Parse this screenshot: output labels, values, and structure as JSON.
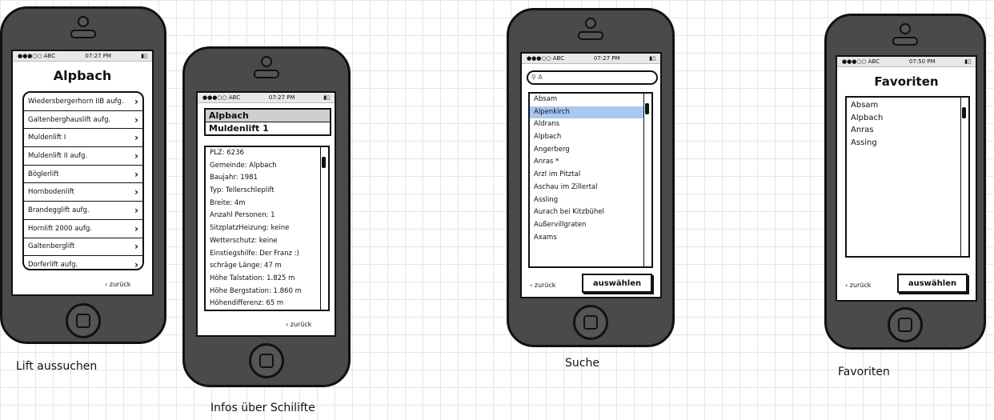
{
  "status": {
    "carrier": "●●●○○ ABC",
    "time1": "07:27 PM",
    "time4": "07:50 PM",
    "battery": "▮▯"
  },
  "back_label": "‹ zurück",
  "screen1": {
    "title": "Alpbach",
    "items": [
      "Wiedersbergerhorn IIB aufg.",
      "Galtenberghauslift aufg.",
      "Muldenlift I",
      "Muldenlift II aufg.",
      "Böglerlift",
      "Hornbodenlift",
      "Brandegglift aufg.",
      "Hornlift 2000 aufg.",
      "Galtenberglift",
      "Dorferlift aufg."
    ],
    "caption": "Lift aussuchen"
  },
  "screen2": {
    "header1": "Alpbach",
    "header2": "Muldenlift 1",
    "details": [
      "PLZ: 6236",
      "Gemeinde: Alpbach",
      "Baujahr: 1981",
      "Typ: Tellerschleplift",
      "Breite: 4m",
      "Anzahl Personen: 1",
      "SitzplatzHeizung: keine",
      "Wetterschutz: keine",
      "Einstiegshilfe: Der Franz :)",
      "schräge Länge: 47 m",
      "Höhe Talstation: 1.825 m",
      "Höhe Bergstation: 1.860 m",
      "Höhendifferenz: 65 m"
    ],
    "caption": "Infos über Schilifte"
  },
  "screen3": {
    "search_value": "A",
    "items": [
      "Absam",
      "Alpenkirch",
      "Aldrans",
      "Alpbach",
      "Angerberg",
      "Anras *",
      "Arzl im Pitztal",
      "Aschau im Zillertal",
      "Assling",
      "Aurach bei Kitzbühel",
      "Außervillgraten",
      "Axams"
    ],
    "selected": "Alpenkirch",
    "select_label": "auswählen",
    "caption": "Suche"
  },
  "screen4": {
    "title": "Favoriten",
    "items": [
      "Absam",
      "Alpbach",
      "Anras",
      "Assing"
    ],
    "select_label": "auswählen",
    "caption": "Favoriten"
  },
  "colors": {
    "selection": "#a9c7ef",
    "header_gray": "#cfcfcf"
  }
}
